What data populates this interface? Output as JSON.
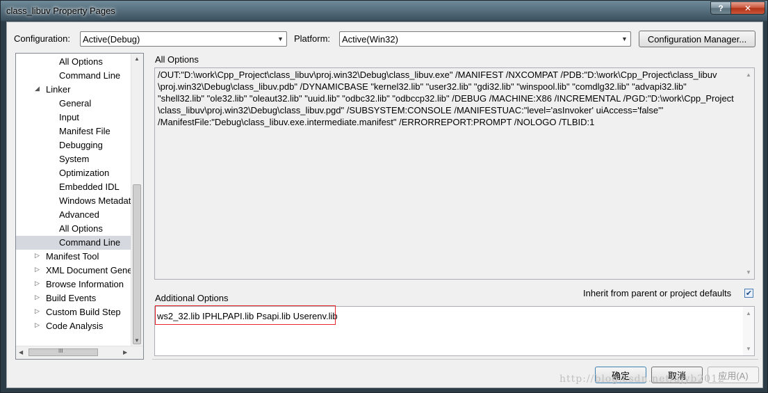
{
  "window": {
    "title": "class_libuv Property Pages",
    "help_label": "?",
    "close_label": "✕"
  },
  "toolbar": {
    "configuration_label": "Configuration:",
    "configuration_value": "Active(Debug)",
    "platform_label": "Platform:",
    "platform_value": "Active(Win32)",
    "config_manager_label": "Configuration Manager..."
  },
  "tree": {
    "selected": "Command Line",
    "items": [
      {
        "label": "All Options",
        "level": 2,
        "expander": ""
      },
      {
        "label": "Command Line",
        "level": 2,
        "expander": ""
      },
      {
        "label": "Linker",
        "level": 1,
        "expander": "◢"
      },
      {
        "label": "General",
        "level": 2,
        "expander": ""
      },
      {
        "label": "Input",
        "level": 2,
        "expander": ""
      },
      {
        "label": "Manifest File",
        "level": 2,
        "expander": ""
      },
      {
        "label": "Debugging",
        "level": 2,
        "expander": ""
      },
      {
        "label": "System",
        "level": 2,
        "expander": ""
      },
      {
        "label": "Optimization",
        "level": 2,
        "expander": ""
      },
      {
        "label": "Embedded IDL",
        "level": 2,
        "expander": ""
      },
      {
        "label": "Windows Metadata",
        "level": 2,
        "expander": ""
      },
      {
        "label": "Advanced",
        "level": 2,
        "expander": ""
      },
      {
        "label": "All Options",
        "level": 2,
        "expander": ""
      },
      {
        "label": "Command Line",
        "level": 2,
        "expander": "",
        "selected": true
      },
      {
        "label": "Manifest Tool",
        "level": 1,
        "expander": "▷"
      },
      {
        "label": "XML Document Generator",
        "level": 1,
        "expander": "▷"
      },
      {
        "label": "Browse Information",
        "level": 1,
        "expander": "▷"
      },
      {
        "label": "Build Events",
        "level": 1,
        "expander": "▷"
      },
      {
        "label": "Custom Build Step",
        "level": 1,
        "expander": "▷"
      },
      {
        "label": "Code Analysis",
        "level": 1,
        "expander": "▷"
      }
    ],
    "hscroll_grip": "III"
  },
  "main": {
    "all_options_heading": "All Options",
    "all_options_lines": [
      "/OUT:\"D:\\work\\Cpp_Project\\class_libuv\\proj.win32\\Debug\\class_libuv.exe\" /MANIFEST /NXCOMPAT /PDB:\"D:\\work\\Cpp_Project\\class_libuv",
      "\\proj.win32\\Debug\\class_libuv.pdb\" /DYNAMICBASE \"kernel32.lib\" \"user32.lib\" \"gdi32.lib\" \"winspool.lib\" \"comdlg32.lib\" \"advapi32.lib\"",
      "\"shell32.lib\" \"ole32.lib\" \"oleaut32.lib\" \"uuid.lib\" \"odbc32.lib\" \"odbccp32.lib\" /DEBUG /MACHINE:X86 /INCREMENTAL /PGD:\"D:\\work\\Cpp_Project",
      "\\class_libuv\\proj.win32\\Debug\\class_libuv.pgd\" /SUBSYSTEM:CONSOLE /MANIFESTUAC:\"level='asInvoker' uiAccess='false'\"",
      "/ManifestFile:\"Debug\\class_libuv.exe.intermediate.manifest\" /ERRORREPORT:PROMPT /NOLOGO /TLBID:1"
    ],
    "additional_options_heading": "Additional Options",
    "inherit_label": "Inherit from parent or project defaults",
    "inherit_checked": true,
    "additional_options_value": "ws2_32.lib IPHLPAPI.lib Psapi.lib Userenv.lib"
  },
  "footer": {
    "ok_label": "确定",
    "cancel_label": "取消",
    "apply_label": "应用(A)",
    "watermark": "http://blog.csdn.net/ajyb2012"
  },
  "colors": {
    "highlight_border": "#e8242c",
    "selection_bg": "#d5d9df"
  }
}
